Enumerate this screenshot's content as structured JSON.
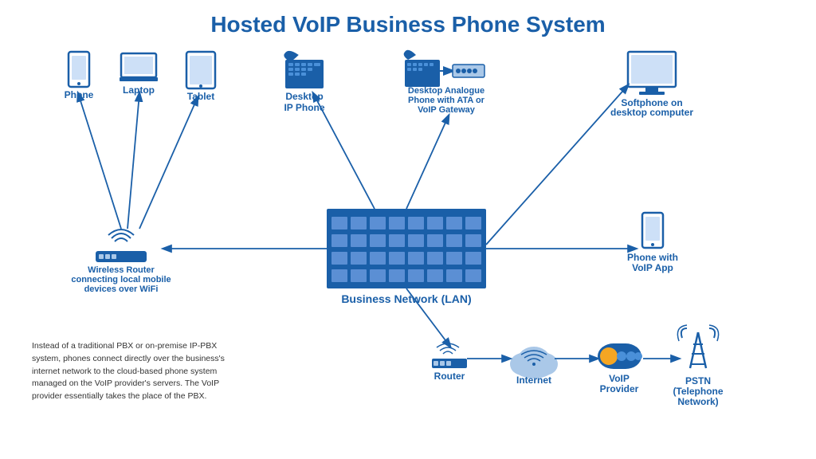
{
  "title": "Hosted VoIP Business Phone System",
  "devices": {
    "phone": {
      "label": "Phone"
    },
    "laptop": {
      "label": "Laptop"
    },
    "tablet": {
      "label": "Tablet"
    },
    "desktop_ip": {
      "label": "Desktop\nIP Phone"
    },
    "desktop_analogue": {
      "label": "Desktop Analogue\nPhone with ATA or\nVoIP Gateway"
    },
    "softphone": {
      "label": "Softphone on\ndesktop computer"
    },
    "wireless_router": {
      "label": "Wireless Router\nconnecting local mobile\ndevices over WiFi"
    },
    "business_network": {
      "label": "Business Network (LAN)"
    },
    "phone_voip": {
      "label": "Phone with\nVoIP App"
    },
    "router": {
      "label": "Router"
    },
    "internet": {
      "label": "Internet"
    },
    "voip_provider": {
      "label": "VoIP\nProvider"
    },
    "pstn": {
      "label": "PSTN\n(Telephone\nNetwork)"
    }
  },
  "description": "Instead of a traditional PBX or on-premise IP-PBX system, phones connect directly over the business's internet network to the cloud-based phone system managed on the VoIP provider's servers. The VoIP provider essentially takes the place of the PBX.",
  "colors": {
    "blue": "#1a5fa8",
    "light_blue": "#4a90d9",
    "dark_blue": "#0d3d6e"
  }
}
